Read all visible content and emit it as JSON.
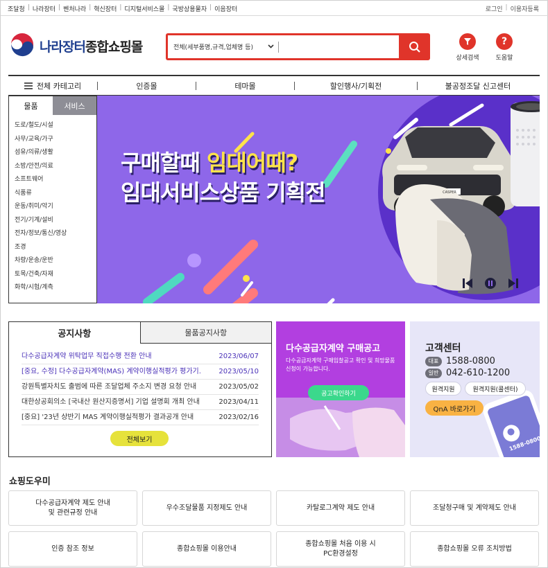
{
  "top": {
    "links": [
      "조달청",
      "나라장터",
      "벤처나라",
      "혁신장터",
      "디지털서비스몰",
      "국방상용물자",
      "이음장터"
    ],
    "util": [
      "로그인",
      "이용자등록"
    ]
  },
  "header": {
    "logo_text_a": "나라장터",
    "logo_text_b": "종합쇼핑몰",
    "search_category": "전체(세부품명,규격,업체명 등)",
    "search_placeholder": "",
    "adv_search": "상세검색",
    "help": "도움말"
  },
  "nav": {
    "all": "전체 카테고리",
    "items": [
      "인증몰",
      "테마몰",
      "할인행사/기획전",
      "불공정조달 신고센터"
    ]
  },
  "category": {
    "tab_goods": "물품",
    "tab_service": "서비스",
    "items": [
      "도로/철도/시설",
      "사무/교육/가구",
      "섬유/의류/생활",
      "소방/안전/의료",
      "소프트웨어",
      "식품류",
      "운동/취미/악기",
      "전기/기계/설비",
      "전자/정보/통신/영상",
      "조경",
      "차량/운송/운반",
      "토목/건축/자재",
      "화학/시험/계측"
    ]
  },
  "banner": {
    "line1_a": "구매할때 ",
    "line1_b": "임대어때?",
    "line2": "임대서비스상품 기획전",
    "car_plate": "CASPER"
  },
  "notice": {
    "tab_on": "공지사항",
    "tab_off": "물품공지사항",
    "rows": [
      {
        "title": "다수공급자계약 위탁업무 직접수행 전환 안내",
        "date": "2023/06/07"
      },
      {
        "title": "[중요, 수정] 다수공급자계약(MAS) 계약이행실적평가 평가기...",
        "date": "2023/05/10"
      },
      {
        "title": "강원특별자치도 출범에 따른 조달업체 주소지 변경 요청 안내",
        "date": "2023/05/02"
      },
      {
        "title": "대한상공회의소 [국내산 원산지증명서] 기업 설명회 개최 안내",
        "date": "2023/04/11"
      },
      {
        "title": "[중요] '23년 상반기 MAS 계약이행실적평가 결과공개 안내",
        "date": "2023/02/16"
      }
    ],
    "more": "전체보기"
  },
  "mas": {
    "title": "다수공급자계약 구매공고",
    "desc": "다수공급자계약 구매입찰공고 확인 및 희망물품 신청이 가능합니다.",
    "button": "공고확인하기"
  },
  "support": {
    "title": "고객센터",
    "rep_label": "대표",
    "rep_phone": "1588-0800",
    "gen_label": "일반",
    "gen_phone": "042-610-1200",
    "remote": "원격지원",
    "remote_call": "원격지원(콜센터)",
    "qna": "QnA 바로가기",
    "phone_screen": "1588-0800"
  },
  "help": {
    "title": "쇼핑도우미",
    "cards": [
      [
        "다수공급자계약 제도 안내",
        "및 관련규정 안내"
      ],
      [
        "우수조달물품 지정제도 안내"
      ],
      [
        "카탈로그계약 제도 안내"
      ],
      [
        "조달청구매 및 계약제도 안내"
      ],
      [
        "인증 참조 정보"
      ],
      [
        "종합쇼핑몰 이용안내"
      ],
      [
        "종합쇼핑몰 처음 이용 시",
        "PC환경설정"
      ],
      [
        "종합쇼핑몰 오류 조치방법"
      ]
    ]
  },
  "colors": {
    "accent": "#e0342a",
    "banner": "#8e67e9",
    "mas": "#b23fe0",
    "support": "#e7e6f8",
    "notice_highlight": "#4a31b8"
  }
}
